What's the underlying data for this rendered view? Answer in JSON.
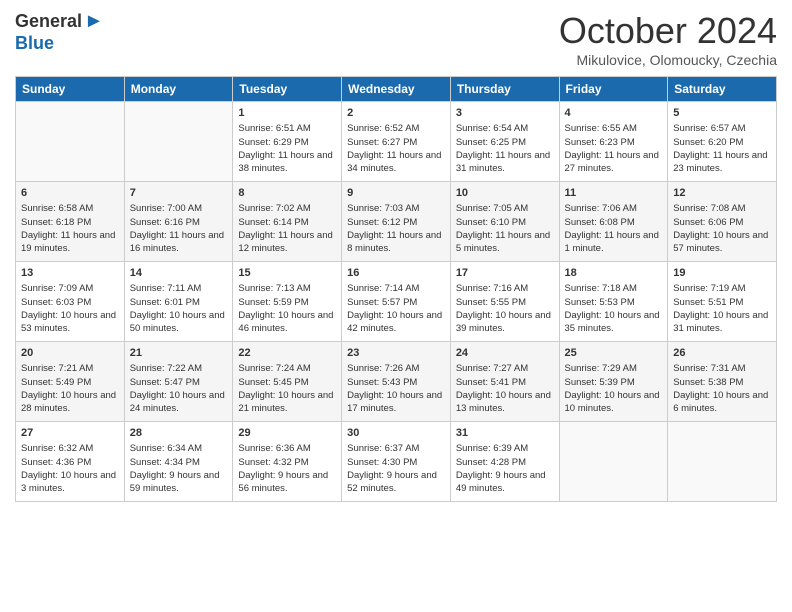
{
  "logo": {
    "general": "General",
    "blue": "Blue"
  },
  "title": "October 2024",
  "location": "Mikulovice, Olomoucky, Czechia",
  "days": [
    "Sunday",
    "Monday",
    "Tuesday",
    "Wednesday",
    "Thursday",
    "Friday",
    "Saturday"
  ],
  "weeks": [
    [
      {
        "day": "",
        "content": ""
      },
      {
        "day": "",
        "content": ""
      },
      {
        "day": "1",
        "content": "Sunrise: 6:51 AM\nSunset: 6:29 PM\nDaylight: 11 hours and 38 minutes."
      },
      {
        "day": "2",
        "content": "Sunrise: 6:52 AM\nSunset: 6:27 PM\nDaylight: 11 hours and 34 minutes."
      },
      {
        "day": "3",
        "content": "Sunrise: 6:54 AM\nSunset: 6:25 PM\nDaylight: 11 hours and 31 minutes."
      },
      {
        "day": "4",
        "content": "Sunrise: 6:55 AM\nSunset: 6:23 PM\nDaylight: 11 hours and 27 minutes."
      },
      {
        "day": "5",
        "content": "Sunrise: 6:57 AM\nSunset: 6:20 PM\nDaylight: 11 hours and 23 minutes."
      }
    ],
    [
      {
        "day": "6",
        "content": "Sunrise: 6:58 AM\nSunset: 6:18 PM\nDaylight: 11 hours and 19 minutes."
      },
      {
        "day": "7",
        "content": "Sunrise: 7:00 AM\nSunset: 6:16 PM\nDaylight: 11 hours and 16 minutes."
      },
      {
        "day": "8",
        "content": "Sunrise: 7:02 AM\nSunset: 6:14 PM\nDaylight: 11 hours and 12 minutes."
      },
      {
        "day": "9",
        "content": "Sunrise: 7:03 AM\nSunset: 6:12 PM\nDaylight: 11 hours and 8 minutes."
      },
      {
        "day": "10",
        "content": "Sunrise: 7:05 AM\nSunset: 6:10 PM\nDaylight: 11 hours and 5 minutes."
      },
      {
        "day": "11",
        "content": "Sunrise: 7:06 AM\nSunset: 6:08 PM\nDaylight: 11 hours and 1 minute."
      },
      {
        "day": "12",
        "content": "Sunrise: 7:08 AM\nSunset: 6:06 PM\nDaylight: 10 hours and 57 minutes."
      }
    ],
    [
      {
        "day": "13",
        "content": "Sunrise: 7:09 AM\nSunset: 6:03 PM\nDaylight: 10 hours and 53 minutes."
      },
      {
        "day": "14",
        "content": "Sunrise: 7:11 AM\nSunset: 6:01 PM\nDaylight: 10 hours and 50 minutes."
      },
      {
        "day": "15",
        "content": "Sunrise: 7:13 AM\nSunset: 5:59 PM\nDaylight: 10 hours and 46 minutes."
      },
      {
        "day": "16",
        "content": "Sunrise: 7:14 AM\nSunset: 5:57 PM\nDaylight: 10 hours and 42 minutes."
      },
      {
        "day": "17",
        "content": "Sunrise: 7:16 AM\nSunset: 5:55 PM\nDaylight: 10 hours and 39 minutes."
      },
      {
        "day": "18",
        "content": "Sunrise: 7:18 AM\nSunset: 5:53 PM\nDaylight: 10 hours and 35 minutes."
      },
      {
        "day": "19",
        "content": "Sunrise: 7:19 AM\nSunset: 5:51 PM\nDaylight: 10 hours and 31 minutes."
      }
    ],
    [
      {
        "day": "20",
        "content": "Sunrise: 7:21 AM\nSunset: 5:49 PM\nDaylight: 10 hours and 28 minutes."
      },
      {
        "day": "21",
        "content": "Sunrise: 7:22 AM\nSunset: 5:47 PM\nDaylight: 10 hours and 24 minutes."
      },
      {
        "day": "22",
        "content": "Sunrise: 7:24 AM\nSunset: 5:45 PM\nDaylight: 10 hours and 21 minutes."
      },
      {
        "day": "23",
        "content": "Sunrise: 7:26 AM\nSunset: 5:43 PM\nDaylight: 10 hours and 17 minutes."
      },
      {
        "day": "24",
        "content": "Sunrise: 7:27 AM\nSunset: 5:41 PM\nDaylight: 10 hours and 13 minutes."
      },
      {
        "day": "25",
        "content": "Sunrise: 7:29 AM\nSunset: 5:39 PM\nDaylight: 10 hours and 10 minutes."
      },
      {
        "day": "26",
        "content": "Sunrise: 7:31 AM\nSunset: 5:38 PM\nDaylight: 10 hours and 6 minutes."
      }
    ],
    [
      {
        "day": "27",
        "content": "Sunrise: 6:32 AM\nSunset: 4:36 PM\nDaylight: 10 hours and 3 minutes."
      },
      {
        "day": "28",
        "content": "Sunrise: 6:34 AM\nSunset: 4:34 PM\nDaylight: 9 hours and 59 minutes."
      },
      {
        "day": "29",
        "content": "Sunrise: 6:36 AM\nSunset: 4:32 PM\nDaylight: 9 hours and 56 minutes."
      },
      {
        "day": "30",
        "content": "Sunrise: 6:37 AM\nSunset: 4:30 PM\nDaylight: 9 hours and 52 minutes."
      },
      {
        "day": "31",
        "content": "Sunrise: 6:39 AM\nSunset: 4:28 PM\nDaylight: 9 hours and 49 minutes."
      },
      {
        "day": "",
        "content": ""
      },
      {
        "day": "",
        "content": ""
      }
    ]
  ]
}
